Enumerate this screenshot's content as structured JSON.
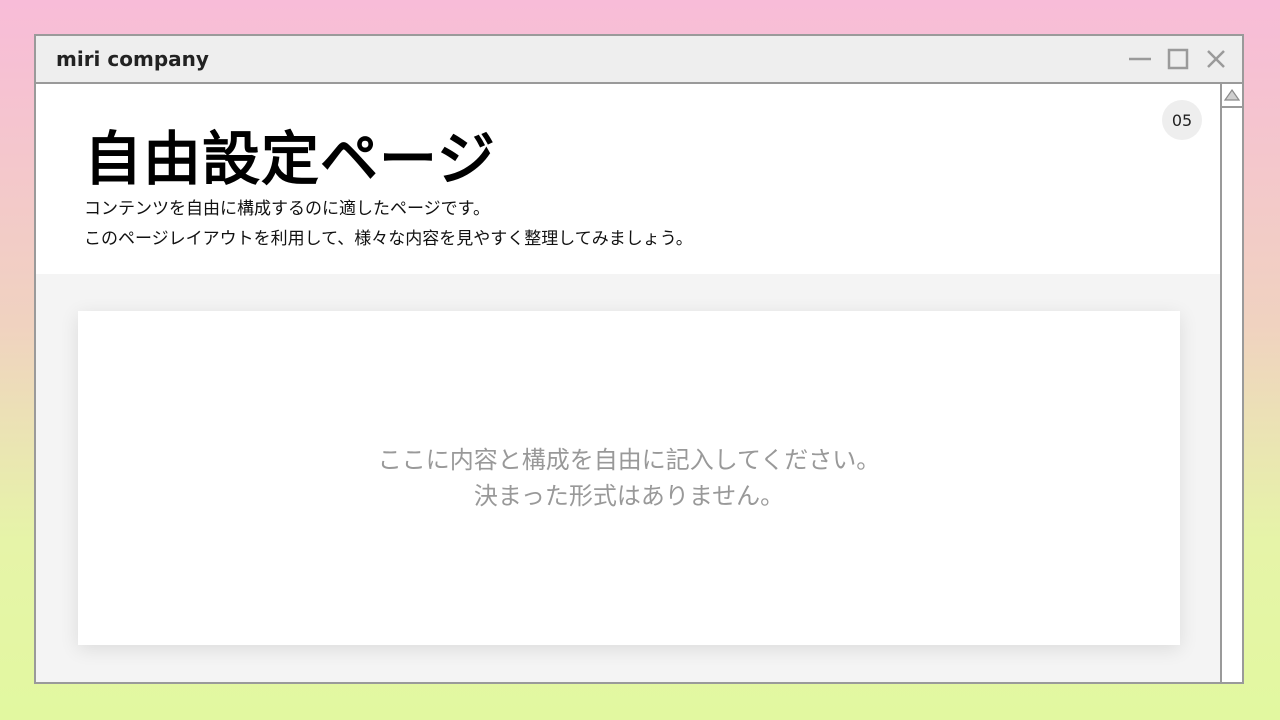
{
  "window": {
    "title": "miri company",
    "controls": {
      "minimize_icon": "minimize-icon",
      "maximize_icon": "maximize-icon",
      "close_icon": "close-icon"
    }
  },
  "page": {
    "title": "自由設定ページ",
    "description": [
      "コンテンツを自由に構成するのに適したページです。",
      "このページレイアウトを利用して、様々な内容を見やすく整理してみましょう。"
    ],
    "page_number": "05"
  },
  "card": {
    "lines": [
      "ここに内容と構成を自由に記入してください。",
      "決まった形式はありません。"
    ]
  },
  "scrollbar": {
    "up_icon": "triangle-up-icon"
  },
  "colors": {
    "background_top": "#f8bcd8",
    "background_bottom": "#e2f8a0",
    "window_border": "#9a9a9a",
    "titlebar": "#eeeeee",
    "body_area": "#f4f4f4",
    "card_text": "#999999"
  }
}
